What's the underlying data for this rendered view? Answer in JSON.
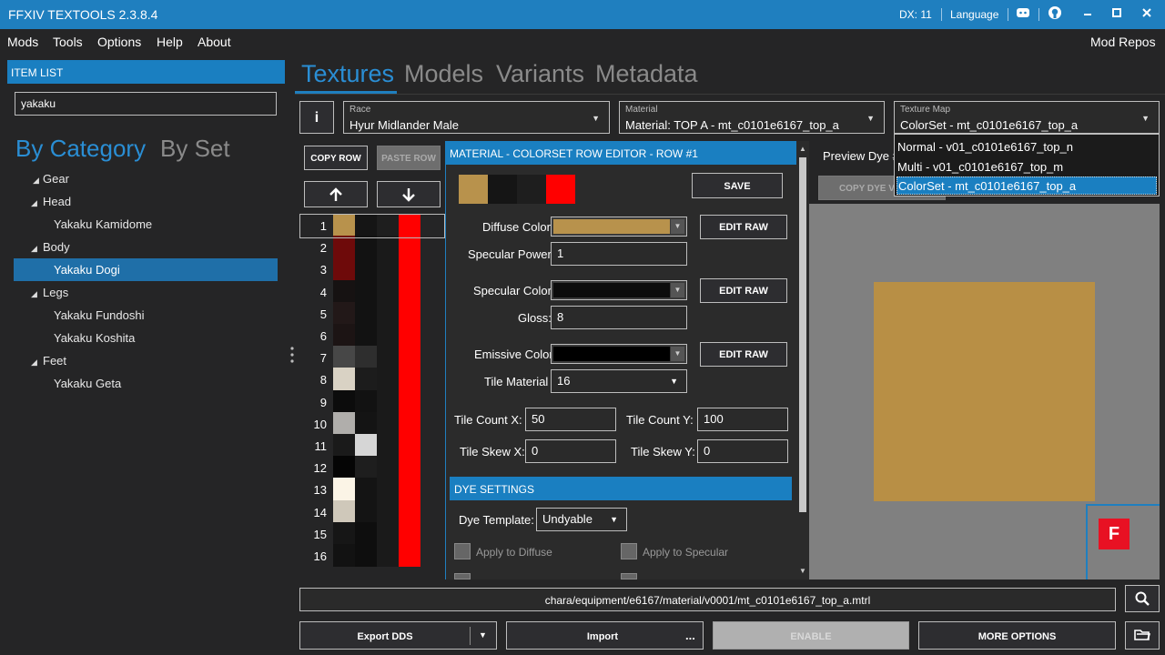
{
  "window": {
    "title": "FFXIV TEXTOOLS 2.3.8.4",
    "dx": "DX: 11",
    "language": "Language"
  },
  "menu": {
    "items": [
      "Mods",
      "Tools",
      "Options",
      "Help",
      "About"
    ],
    "right": "Mod Repos"
  },
  "item_list": {
    "header": "ITEM LIST",
    "search_value": "yakaku",
    "tabs": [
      "By Category",
      "By Set"
    ],
    "tree": [
      {
        "label": "Gear",
        "level": 0,
        "expanded": true
      },
      {
        "label": "Head",
        "level": 1,
        "expanded": true
      },
      {
        "label": "Yakaku Kamidome",
        "level": 2
      },
      {
        "label": "Body",
        "level": 1,
        "expanded": true
      },
      {
        "label": "Yakaku Dogi",
        "level": 2,
        "selected": true
      },
      {
        "label": "Legs",
        "level": 1,
        "expanded": true
      },
      {
        "label": "Yakaku Fundoshi",
        "level": 2
      },
      {
        "label": "Yakaku Koshita",
        "level": 2
      },
      {
        "label": "Feet",
        "level": 1,
        "expanded": true
      },
      {
        "label": "Yakaku Geta",
        "level": 2
      }
    ]
  },
  "main_tabs": [
    "Textures",
    "Models",
    "Variants",
    "Metadata"
  ],
  "race": {
    "label": "Race",
    "value": "Hyur Midlander Male"
  },
  "material": {
    "label": "Material",
    "value": "Material: TOP A - mt_c0101e6167_top_a"
  },
  "texture_map": {
    "label": "Texture Map",
    "value": "ColorSet - mt_c0101e6167_top_a",
    "options": [
      "Normal - v01_c0101e6167_top_n",
      "Multi - v01_c0101e6167_top_m",
      "ColorSet - mt_c0101e6167_top_a"
    ]
  },
  "colorset": {
    "copy_row": "COPY ROW",
    "paste_row": "PASTE ROW",
    "up_icon": "arrow-up-icon",
    "down_icon": "arrow-down-icon",
    "rows": [
      {
        "n": "1",
        "c": [
          "#b8924c",
          "#151515",
          "#1e1e1e",
          "#ff0000"
        ]
      },
      {
        "n": "2",
        "c": [
          "#6e0a0a",
          "#121212",
          "#1a1a1a",
          "#ff0000"
        ]
      },
      {
        "n": "3",
        "c": [
          "#6e0a0a",
          "#121212",
          "#1a1a1a",
          "#ff0000"
        ]
      },
      {
        "n": "4",
        "c": [
          "#161212",
          "#121212",
          "#1a1a1a",
          "#ff0000"
        ]
      },
      {
        "n": "5",
        "c": [
          "#221818",
          "#121212",
          "#1a1a1a",
          "#ff0000"
        ]
      },
      {
        "n": "6",
        "c": [
          "#1c1414",
          "#121212",
          "#1a1a1a",
          "#ff0000"
        ]
      },
      {
        "n": "7",
        "c": [
          "#474747",
          "#2e2e2e",
          "#1a1a1a",
          "#ff0000"
        ]
      },
      {
        "n": "8",
        "c": [
          "#d9d2c4",
          "#1c1c1c",
          "#1a1a1a",
          "#ff0000"
        ]
      },
      {
        "n": "9",
        "c": [
          "#0c0c0c",
          "#121212",
          "#1a1a1a",
          "#ff0000"
        ]
      },
      {
        "n": "10",
        "c": [
          "#b0aeab",
          "#141414",
          "#1a1a1a",
          "#ff0000"
        ]
      },
      {
        "n": "11",
        "c": [
          "#1a1a1a",
          "#d6d6d6",
          "#1a1a1a",
          "#ff0000"
        ]
      },
      {
        "n": "12",
        "c": [
          "#050505",
          "#1e1e1e",
          "#1a1a1a",
          "#ff0000"
        ]
      },
      {
        "n": "13",
        "c": [
          "#fbf4e6",
          "#141414",
          "#1a1a1a",
          "#ff0000"
        ]
      },
      {
        "n": "14",
        "c": [
          "#cfc8ba",
          "#141414",
          "#1a1a1a",
          "#ff0000"
        ]
      },
      {
        "n": "15",
        "c": [
          "#161616",
          "#0e0e0e",
          "#1a1a1a",
          "#ff0000"
        ]
      },
      {
        "n": "16",
        "c": [
          "#121212",
          "#0e0e0e",
          "#1a1a1a",
          "#ff0000"
        ]
      }
    ]
  },
  "row_editor": {
    "header": "MATERIAL - COLORSET ROW EDITOR - ROW #1",
    "preview_colors": [
      "#b8924c",
      "#151515",
      "#1e1e1e",
      "#ff0000"
    ],
    "save": "SAVE",
    "diffuse_label": "Diffuse Color",
    "diffuse_color": "#b8924c",
    "edit_raw": "EDIT RAW",
    "spec_power_label": "Specular Power:",
    "spec_power": "1",
    "spec_color_label": "Specular Color",
    "spec_color": "#0c0c0c",
    "gloss_label": "Gloss:",
    "gloss": "8",
    "emissive_label": "Emissive Color",
    "emissive_color": "#000000",
    "tile_material_label": "Tile Material",
    "tile_material": "16",
    "tile_count_x_label": "Tile Count X:",
    "tile_count_x": "50",
    "tile_count_y_label": "Tile Count Y:",
    "tile_count_y": "100",
    "tile_skew_x_label": "Tile Skew X:",
    "tile_skew_x": "0",
    "tile_skew_y_label": "Tile Skew Y:",
    "tile_skew_y": "0",
    "dye_header": "DYE SETTINGS",
    "dye_template_label": "Dye Template:",
    "dye_template": "Undyable",
    "apply_diffuse": "Apply to Diffuse",
    "apply_specular": "Apply to Specular"
  },
  "preview": {
    "label": "Preview Dye #",
    "copy_dye": "COPY DYE VALUES",
    "tile_color": "#b88f45",
    "badge": "F"
  },
  "path": "chara/equipment/e6167/material/v0001/mt_c0101e6167_top_a.mtrl",
  "bottom": {
    "export": "Export DDS",
    "import": "Import",
    "import_more": "...",
    "enable": "ENABLE",
    "more_options": "MORE OPTIONS"
  }
}
